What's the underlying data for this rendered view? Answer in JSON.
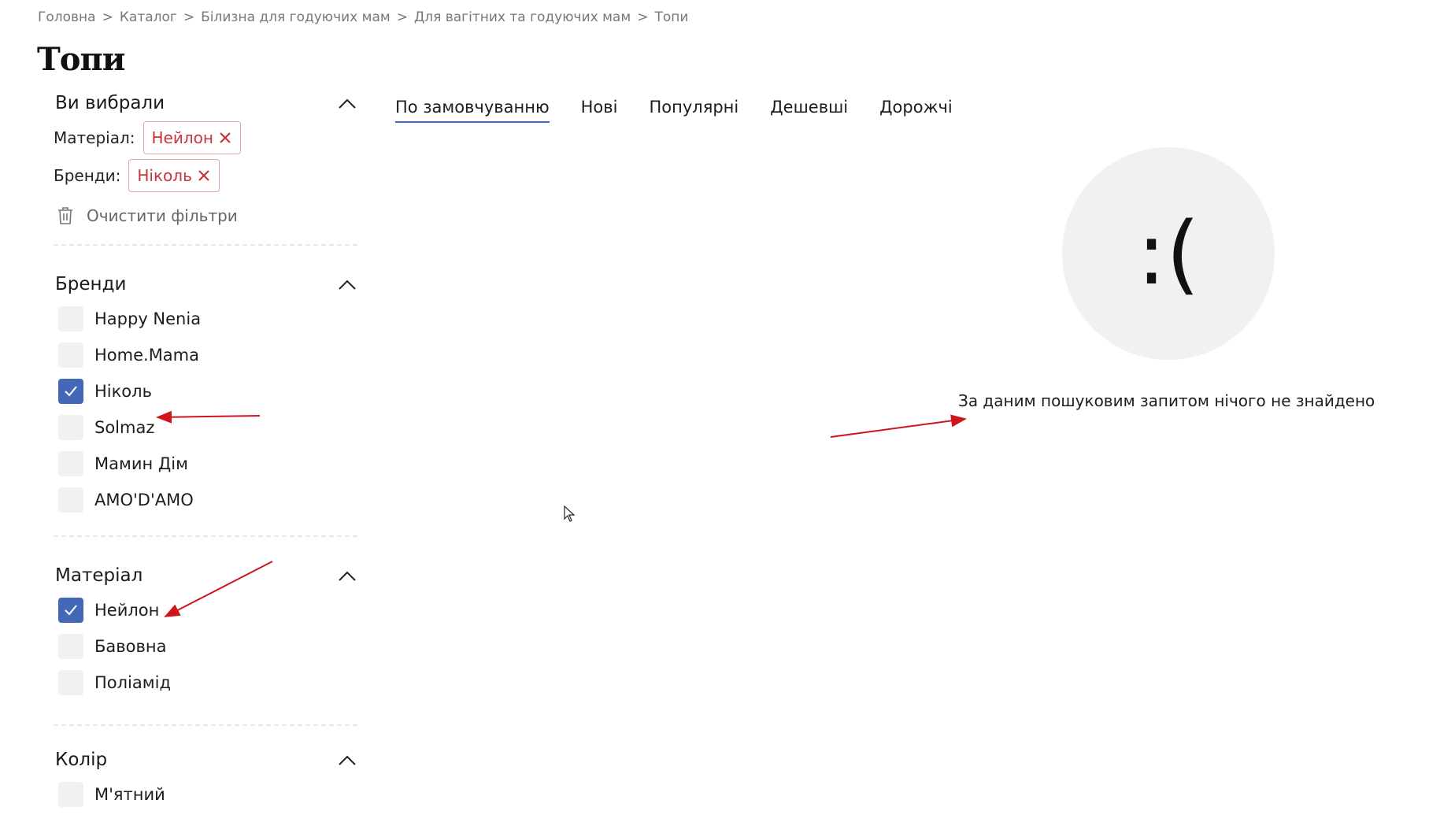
{
  "breadcrumb": [
    "Головна",
    "Каталог",
    "Білизна для годуючих мам",
    "Для вагітних та годуючих мам",
    "Топи"
  ],
  "page_title": "Топи",
  "selected": {
    "title": "Ви вибрали",
    "filters": [
      {
        "label": "Матеріал:",
        "value": "Нейлон"
      },
      {
        "label": "Бренди:",
        "value": "Ніколь"
      }
    ],
    "clear_label": "Очистити фільтри"
  },
  "brands": {
    "title": "Бренди",
    "items": [
      {
        "label": "Happy Nenia",
        "checked": false
      },
      {
        "label": "Home.Mama",
        "checked": false
      },
      {
        "label": "Ніколь",
        "checked": true
      },
      {
        "label": "Solmaz",
        "checked": false
      },
      {
        "label": "Мамин Дім",
        "checked": false
      },
      {
        "label": "AMO'D'AMO",
        "checked": false
      }
    ]
  },
  "material": {
    "title": "Матеріал",
    "items": [
      {
        "label": "Нейлон",
        "checked": true
      },
      {
        "label": "Бавовна",
        "checked": false
      },
      {
        "label": "Поліамід",
        "checked": false
      }
    ]
  },
  "color": {
    "title": "Колір",
    "items": [
      {
        "label": "М'ятний",
        "checked": false
      }
    ]
  },
  "sort_tabs": [
    {
      "label": "По замовчуванню",
      "active": true
    },
    {
      "label": "Нові",
      "active": false
    },
    {
      "label": "Популярні",
      "active": false
    },
    {
      "label": "Дешевші",
      "active": false
    },
    {
      "label": "Дорожчі",
      "active": false
    }
  ],
  "empty": {
    "face": ":(",
    "message": "За даним пошуковим запитом нічого не знайдено"
  },
  "colors": {
    "accent": "#4467b8",
    "chip_text": "#c5353a",
    "chip_border": "#e6a5a5",
    "annotation_arrow": "#d0141c",
    "circle_bg": "#f1f1f1"
  }
}
